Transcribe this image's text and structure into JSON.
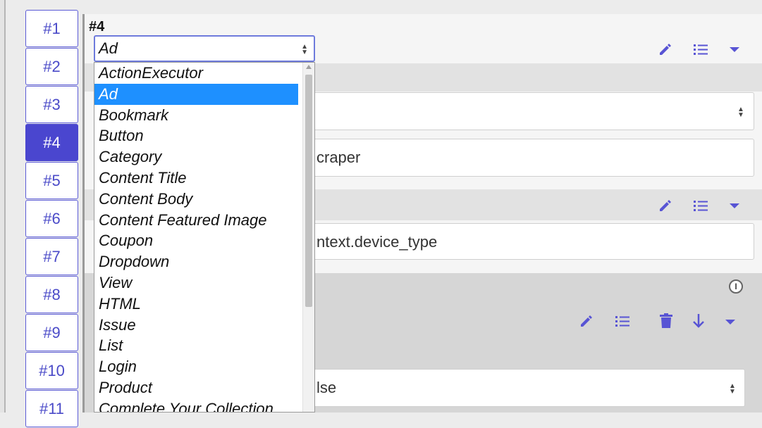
{
  "tabs": [
    "#1",
    "#2",
    "#3",
    "#4",
    "#5",
    "#6",
    "#7",
    "#8",
    "#9",
    "#10",
    "#11"
  ],
  "active_tab": "#4",
  "section_title": "#4",
  "selector": {
    "value": "Ad",
    "options": [
      "ActionExecutor",
      "Ad",
      "Bookmark",
      "Button",
      "Category",
      "Content Title",
      "Content Body",
      "Content Featured Image",
      "Coupon",
      "Dropdown",
      "View",
      "HTML",
      "Issue",
      "List",
      "Login",
      "Product",
      "Complete Your Collection"
    ],
    "selected_index": 1
  },
  "fields": {
    "field2_text": "craper",
    "field3_text": "ntext.device_type",
    "field4_text": "lse"
  },
  "info_icon": "I",
  "colors": {
    "accent": "#4a46cf",
    "icon": "#5854d4",
    "selection": "#1e90ff"
  }
}
